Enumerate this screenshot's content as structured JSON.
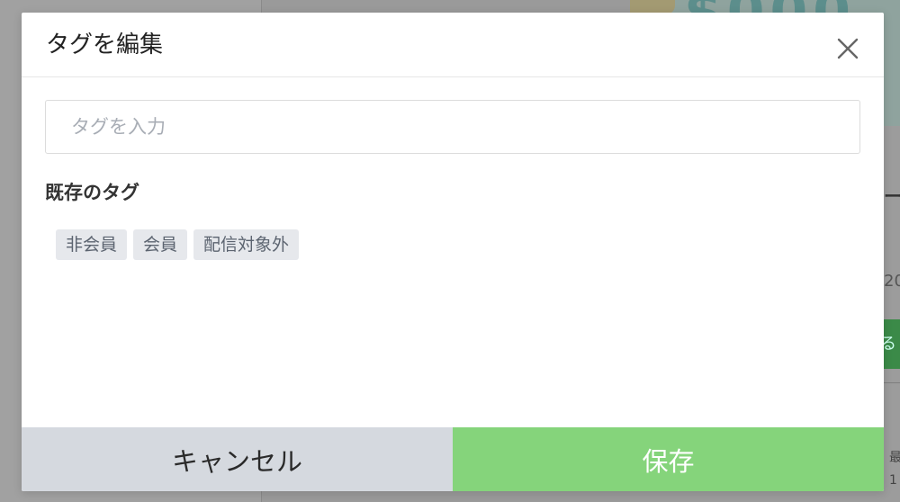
{
  "modal": {
    "title": "タグを編集",
    "close_icon": "close-icon"
  },
  "tag_input": {
    "placeholder": "タグを入力",
    "value": ""
  },
  "existing_tags": {
    "heading": "既存のタグ",
    "tags": [
      "非会員",
      "会員",
      "配信対象外"
    ]
  },
  "footer": {
    "cancel_label": "キャンセル",
    "save_label": "保存"
  },
  "colors": {
    "save_button": "#85d47b",
    "cancel_button": "#d5d9df",
    "tag_chip": "#e6e8ec"
  }
}
